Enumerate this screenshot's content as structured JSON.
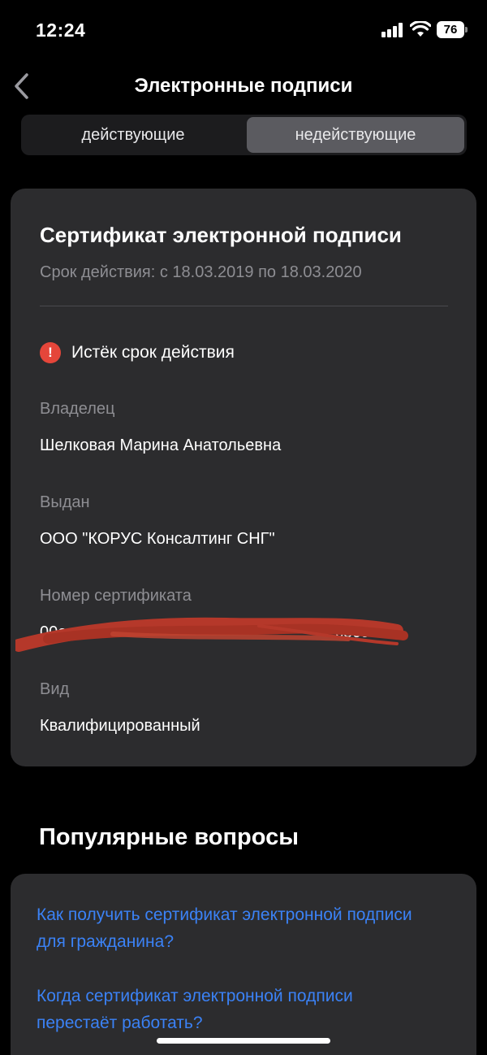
{
  "status_bar": {
    "time": "12:24",
    "battery_level": "76"
  },
  "header": {
    "title": "Электронные подписи",
    "back_icon": "chevron-left-icon"
  },
  "tabs": [
    {
      "label": "действующие",
      "selected": false
    },
    {
      "label": "недействующие",
      "selected": true
    }
  ],
  "certificate": {
    "title": "Сертификат электронной подписи",
    "period": "Срок действия: с 18.03.2019 по 18.03.2020",
    "status": {
      "icon": "alert-icon",
      "icon_glyph": "!",
      "text": "Истёк срок действия",
      "color": "#e5463a"
    },
    "owner": {
      "label": "Владелец",
      "value": "Шелковая Марина Анатольевна"
    },
    "issuer": {
      "label": "Выдан",
      "value": "ООО \"КОРУС Консалтинг СНГ\""
    },
    "number": {
      "label": "Номер сертификата",
      "value_prefix": "00a",
      "value_suffix": "c8c08"
    },
    "type": {
      "label": "Вид",
      "value": "Квалифицированный"
    }
  },
  "faq": {
    "title": "Популярные вопросы",
    "items": [
      {
        "text": "Как получить сертификат электронной подписи для гражданина?"
      },
      {
        "text": "Когда сертификат электронной подписи перестаёт работать?"
      }
    ],
    "link_color": "#3b82f6"
  }
}
